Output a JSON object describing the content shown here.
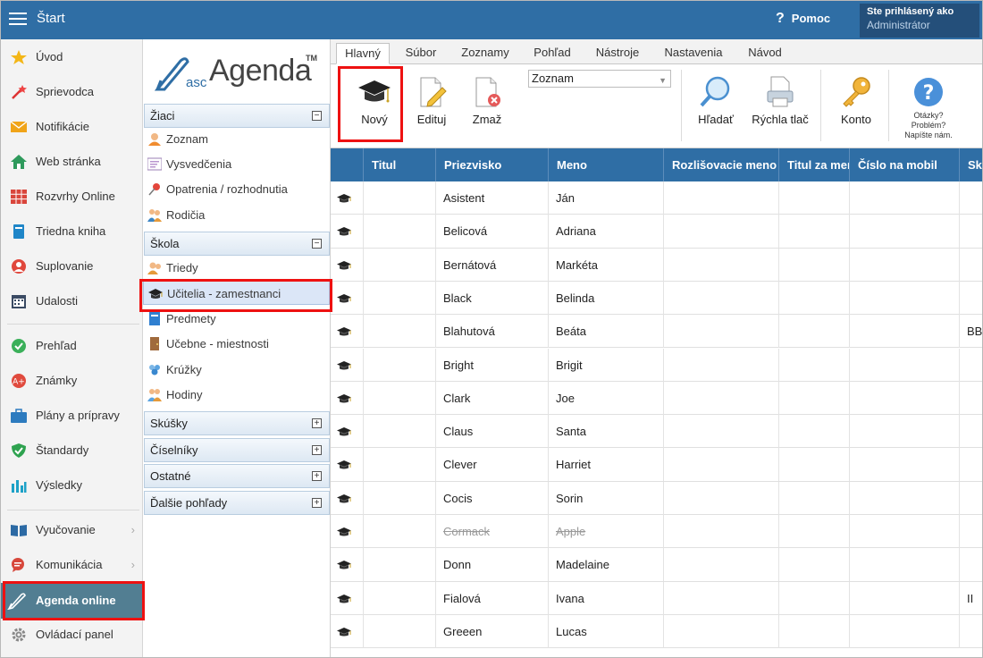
{
  "topbar": {
    "title": "Štart",
    "help_label": "Pomoc",
    "login_line1": "Ste prihlásený ako",
    "login_line2": "Administrátor"
  },
  "sidebar": {
    "items": [
      {
        "label": "Úvod",
        "icon": "star-icon"
      },
      {
        "label": "Sprievodca",
        "icon": "wand-icon"
      },
      {
        "label": "Notifikácie",
        "icon": "envelope-icon"
      },
      {
        "label": "Web stránka",
        "icon": "home-icon"
      },
      {
        "label": "Rozvrhy Online",
        "icon": "timetable-icon"
      },
      {
        "label": "Triedna kniha",
        "icon": "book-icon"
      },
      {
        "label": "Suplovanie",
        "icon": "substitute-icon"
      },
      {
        "label": "Udalosti",
        "icon": "calendar-icon"
      },
      {
        "label": "Prehľad",
        "icon": "check-circle-icon"
      },
      {
        "label": "Známky",
        "icon": "grades-icon"
      },
      {
        "label": "Plány a prípravy",
        "icon": "briefcase-icon"
      },
      {
        "label": "Štandardy",
        "icon": "shield-check-icon"
      },
      {
        "label": "Výsledky",
        "icon": "bar-chart-icon"
      },
      {
        "label": "Vyučovanie",
        "icon": "open-book-icon"
      },
      {
        "label": "Komunikácia",
        "icon": "chat-icon"
      },
      {
        "label": "Agenda online",
        "icon": "pen-icon"
      },
      {
        "label": "Ovládací panel",
        "icon": "gear-icon"
      }
    ]
  },
  "tree": {
    "logo_prefix": "asc",
    "logo_main": "Agenda",
    "logo_tm": "TM",
    "groups": {
      "ziaci": "Žiaci",
      "skola": "Škola",
      "skusky": "Skúšky",
      "ciselniky": "Číselníky",
      "ostatne": "Ostatné",
      "dalsie": "Ďalšie pohľady"
    },
    "ziaci_items": [
      "Zoznam",
      "Vysvedčenia",
      "Opatrenia / rozhodnutia",
      "Rodičia"
    ],
    "skola_items": [
      "Triedy",
      "Učitelia - zamestnanci",
      "Predmety",
      "Učebne - miestnosti",
      "Krúžky",
      "Hodiny"
    ],
    "toggle_collapse": "−",
    "toggle_expand": "+"
  },
  "tabs": [
    "Hlavný",
    "Súbor",
    "Zoznamy",
    "Pohľad",
    "Nástroje",
    "Nastavenia",
    "Návod"
  ],
  "ribbon": {
    "new_label": "Nový",
    "edit_label": "Edituj",
    "delete_label": "Zmaž",
    "view_select_value": "Zoznam",
    "search_label": "Hľadať",
    "print_label": "Rýchla tlač",
    "account_label": "Konto",
    "help_line1": "Otázky?",
    "help_line2": "Problém?",
    "help_line3": "Napíšte nám."
  },
  "grid": {
    "headers": [
      "Titul",
      "Priezvisko",
      "Meno",
      "Rozlišovacie meno",
      "Titul za menom",
      "Číslo na mobil",
      "Sk"
    ],
    "rows": [
      {
        "titul": "",
        "priezvisko": "Asistent",
        "meno": "Ján",
        "extra": "",
        "deleted": false
      },
      {
        "titul": "",
        "priezvisko": "Belicová",
        "meno": "Adriana",
        "extra": "",
        "deleted": false
      },
      {
        "titul": "",
        "priezvisko": "Bernátová",
        "meno": "Markéta",
        "extra": "",
        "deleted": false
      },
      {
        "titul": "",
        "priezvisko": "Black",
        "meno": "Belinda",
        "extra": "",
        "deleted": false
      },
      {
        "titul": "",
        "priezvisko": "Blahutová",
        "meno": "Beáta",
        "extra": "BB",
        "deleted": false
      },
      {
        "titul": "",
        "priezvisko": "Bright",
        "meno": "Brigit",
        "extra": "",
        "deleted": false
      },
      {
        "titul": "",
        "priezvisko": "Clark",
        "meno": "Joe",
        "extra": "",
        "deleted": false
      },
      {
        "titul": "",
        "priezvisko": "Claus",
        "meno": "Santa",
        "extra": "",
        "deleted": false
      },
      {
        "titul": "",
        "priezvisko": "Clever",
        "meno": "Harriet",
        "extra": "",
        "deleted": false
      },
      {
        "titul": "",
        "priezvisko": "Cocis",
        "meno": "Sorin",
        "extra": "",
        "deleted": false
      },
      {
        "titul": "",
        "priezvisko": "Cormack",
        "meno": "Apple",
        "extra": "",
        "deleted": true
      },
      {
        "titul": "",
        "priezvisko": "Donn",
        "meno": "Madelaine",
        "extra": "",
        "deleted": false
      },
      {
        "titul": "",
        "priezvisko": "Fialová",
        "meno": "Ivana",
        "extra": "II",
        "deleted": false
      },
      {
        "titul": "",
        "priezvisko": "Greeen",
        "meno": "Lucas",
        "extra": "",
        "deleted": false
      }
    ]
  },
  "colors": {
    "topbar": "#2f6ea5",
    "highlight": "#e11111",
    "active_sidebar": "#527e92"
  }
}
